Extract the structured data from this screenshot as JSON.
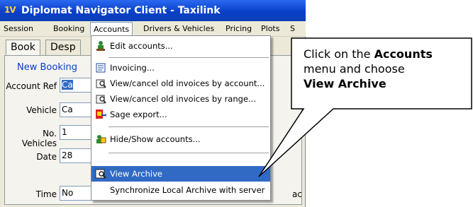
{
  "window": {
    "title": "Diplomat Navigator Client - Taxilink",
    "app_icon_text": "1V"
  },
  "menubar": {
    "items": [
      {
        "label": "Session"
      },
      {
        "label": "Booking"
      },
      {
        "label": "Accounts"
      },
      {
        "label": "Drivers & Vehicles"
      },
      {
        "label": "Pricing"
      },
      {
        "label": "Plots"
      },
      {
        "label": "S"
      }
    ]
  },
  "tabs": [
    {
      "label": "Book"
    },
    {
      "label": "Desp"
    }
  ],
  "form": {
    "section_title": "New Booking",
    "account_ref": {
      "label": "Account Ref",
      "value": "Ca"
    },
    "vehicle": {
      "label": "Vehicle",
      "value": "Ca"
    },
    "no_vehicles": {
      "label": "No. Vehicles",
      "value": "1"
    },
    "date": {
      "label": "Date",
      "value": "28"
    },
    "time": {
      "label": "Time",
      "value": "No"
    },
    "side_text": "ac"
  },
  "dropdown": {
    "items": [
      {
        "label": "Edit accounts...",
        "icon": "edit-accounts-icon"
      },
      {
        "label": "Invoicing...",
        "icon": "invoicing-icon"
      },
      {
        "label": "View/cancel old invoices by account...",
        "icon": "view-invoices-account-icon"
      },
      {
        "label": "View/cancel old invoices by range...",
        "icon": "view-invoices-range-icon"
      },
      {
        "label": "Sage export...",
        "icon": "sage-export-icon"
      },
      {
        "label": "Hide/Show accounts...",
        "icon": "hide-show-accounts-icon"
      },
      {
        "label": "View Archive",
        "icon": "view-archive-icon"
      },
      {
        "label": "Synchronize Local Archive with server",
        "icon": ""
      }
    ]
  },
  "callout": {
    "line1_prefix": "Click on the ",
    "line1_bold": "Accounts",
    "line2": "menu and choose",
    "line3_bold": "View Archive"
  },
  "colors": {
    "titlebar": "#0a3fc8",
    "highlight": "#316ac5",
    "section_title": "#0a3ccd"
  }
}
